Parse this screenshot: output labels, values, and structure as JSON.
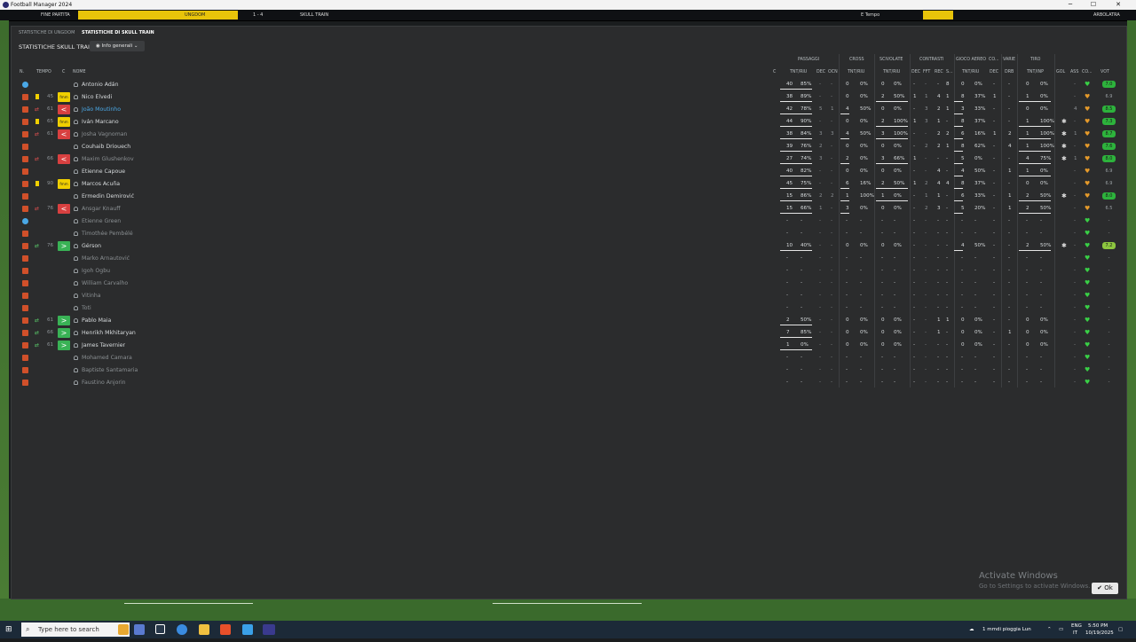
{
  "window": {
    "title": "Football Manager 2024",
    "min": "─",
    "max": "☐",
    "close": "✕"
  },
  "gamebar": {
    "end": "FINE PARTITA",
    "home": "UNGDOM",
    "score": "1 - 4",
    "away": "SKULL TRAIN",
    "time": "E Tempo",
    "right": "ARBOLATRA"
  },
  "tabs": [
    "STATISTICHE DI UNGDOM",
    "STATISTICHE DI SKULL TRAIN"
  ],
  "subtitle": "STATISTICHE SKULL TRAIN",
  "dropdown": {
    "label": "Info generali",
    "icon": "eye-icon"
  },
  "groups": {
    "passaggi": "PASSAGGI",
    "cross": "CROSS",
    "scivolate": "SCIVOLATE",
    "contrasti": "CONTRASTI",
    "gioco_aereo": "GIOCO AEREO",
    "co": "CO...",
    "varie": "VARIE",
    "tiro": "TIRO"
  },
  "headers": {
    "n": "N.",
    "tempo": "TEMPO",
    "c": "C",
    "nome": "NOME",
    "c2": "C",
    "pass_tnt": "TNT/RIU",
    "pass_dec": "DEC",
    "pass_occ": "OCN",
    "cross_tnt": "TNT/RIU",
    "sciv_tnt": "TNT/RIU",
    "contr_dec": "DEC",
    "contr_fft": "FFT",
    "contr_rec": "REC",
    "contr_s": "S...",
    "aereo_tnt": "TNT/RIU",
    "aereo_dec": "DEC",
    "varie_drb": "DRB",
    "tiro_tnt": "TNT/INP",
    "gol": "GOL",
    "ass": "ASS",
    "co": "CO...",
    "vot": "VOT"
  },
  "players": [
    {
      "name": "Antonio Adán",
      "style": "normal",
      "pos": "gk",
      "card": "",
      "sub": "",
      "min": "",
      "badge": "",
      "shirt": "",
      "pass": [
        "40",
        "85%"
      ],
      "dec": "-",
      "occ": "-",
      "cross": [
        "0",
        "0%"
      ],
      "sciv": [
        "0",
        "0%"
      ],
      "cd": "-",
      "cf": "-",
      "cr": "-",
      "cs": "8",
      "aer": [
        "0",
        "0%"
      ],
      "adec": "-",
      "drb": "-",
      "tiro": [
        "0",
        "0%"
      ],
      "gol": "",
      "ass": "-",
      "heart": "g",
      "rating": "7.0",
      "rclass": "g"
    },
    {
      "name": "Nico Elvedi",
      "style": "normal",
      "pos": "out",
      "card": "y",
      "sub": "",
      "min": "45",
      "badge": "cap",
      "shirt": "",
      "pass": [
        "38",
        "89%"
      ],
      "dec": "-",
      "occ": "-",
      "cross": [
        "0",
        "0%"
      ],
      "sciv": [
        "2",
        "50%"
      ],
      "cd": "1",
      "cf": "1",
      "cr": "4",
      "cs": "1",
      "aer": [
        "8",
        "37%"
      ],
      "adec": "1",
      "drb": "-",
      "tiro": [
        "1",
        "0%"
      ],
      "gol": "",
      "ass": "-",
      "heart": "o",
      "rating": "6.9",
      "rclass": "none"
    },
    {
      "name": "João Moutinho",
      "style": "blue",
      "pos": "out",
      "card": "",
      "sub": "out",
      "min": "61",
      "badge": "off",
      "shirt": "",
      "pass": [
        "42",
        "78%"
      ],
      "dec": "5",
      "occ": "1",
      "cross": [
        "4",
        "50%"
      ],
      "sciv": [
        "0",
        "0%"
      ],
      "cd": "-",
      "cf": "3",
      "cr": "2",
      "cs": "1",
      "aer": [
        "3",
        "33%"
      ],
      "adec": "-",
      "drb": "-",
      "tiro": [
        "0",
        "0%"
      ],
      "gol": "",
      "ass": "4",
      "heart": "o",
      "rating": "8.5",
      "rclass": "g"
    },
    {
      "name": "Iván Marcano",
      "style": "normal",
      "pos": "out",
      "card": "y",
      "sub": "",
      "min": "65",
      "badge": "cap",
      "shirt": "",
      "pass": [
        "44",
        "90%"
      ],
      "dec": "-",
      "occ": "-",
      "cross": [
        "0",
        "0%"
      ],
      "sciv": [
        "2",
        "100%"
      ],
      "cd": "1",
      "cf": "3",
      "cr": "1",
      "cs": "-",
      "aer": [
        "8",
        "37%"
      ],
      "adec": "-",
      "drb": "-",
      "tiro": [
        "1",
        "100%"
      ],
      "gol": "g",
      "ass": "-",
      "heart": "o",
      "rating": "7.3",
      "rclass": "g"
    },
    {
      "name": "Josha Vagnoman",
      "style": "grey",
      "pos": "out",
      "card": "",
      "sub": "out",
      "min": "61",
      "badge": "off",
      "shirt": "",
      "pass": [
        "38",
        "84%"
      ],
      "dec": "3",
      "occ": "3",
      "cross": [
        "4",
        "50%"
      ],
      "sciv": [
        "3",
        "100%"
      ],
      "cd": "-",
      "cf": "-",
      "cr": "2",
      "cs": "2",
      "aer": [
        "6",
        "16%"
      ],
      "adec": "1",
      "drb": "2",
      "tiro": [
        "1",
        "100%"
      ],
      "gol": "g",
      "ass": "1",
      "heart": "o",
      "rating": "8.7",
      "rclass": "g"
    },
    {
      "name": "Couhaib Driouech",
      "style": "normal",
      "pos": "out",
      "card": "",
      "sub": "",
      "min": "",
      "badge": "",
      "shirt": "",
      "pass": [
        "39",
        "76%"
      ],
      "dec": "2",
      "occ": "-",
      "cross": [
        "0",
        "0%"
      ],
      "sciv": [
        "0",
        "0%"
      ],
      "cd": "-",
      "cf": "2",
      "cr": "2",
      "cs": "1",
      "aer": [
        "8",
        "62%"
      ],
      "adec": "-",
      "drb": "4",
      "tiro": [
        "1",
        "100%"
      ],
      "gol": "g",
      "ass": "-",
      "heart": "o",
      "rating": "7.6",
      "rclass": "g"
    },
    {
      "name": "Maxim Glushenkov",
      "style": "grey",
      "pos": "out",
      "card": "",
      "sub": "out",
      "min": "66",
      "badge": "off",
      "shirt": "",
      "pass": [
        "27",
        "74%"
      ],
      "dec": "3",
      "occ": "-",
      "cross": [
        "2",
        "0%"
      ],
      "sciv": [
        "3",
        "66%"
      ],
      "cd": "1",
      "cf": "-",
      "cr": "-",
      "cs": "-",
      "aer": [
        "5",
        "0%"
      ],
      "adec": "-",
      "drb": "-",
      "tiro": [
        "4",
        "75%"
      ],
      "gol": "g",
      "ass": "1",
      "heart": "o",
      "rating": "8.0",
      "rclass": "g"
    },
    {
      "name": "Etienne Capoue",
      "style": "normal",
      "pos": "out",
      "card": "",
      "sub": "",
      "min": "",
      "badge": "",
      "shirt": "",
      "pass": [
        "40",
        "82%"
      ],
      "dec": "-",
      "occ": "-",
      "cross": [
        "0",
        "0%"
      ],
      "sciv": [
        "0",
        "0%"
      ],
      "cd": "-",
      "cf": "-",
      "cr": "4",
      "cs": "-",
      "aer": [
        "4",
        "50%"
      ],
      "adec": "-",
      "drb": "1",
      "tiro": [
        "1",
        "0%"
      ],
      "gol": "",
      "ass": "-",
      "heart": "o",
      "rating": "6.9",
      "rclass": "none"
    },
    {
      "name": "Marcos Acuña",
      "style": "normal",
      "pos": "out",
      "card": "y",
      "sub": "",
      "min": "90",
      "badge": "cap",
      "shirt": "",
      "pass": [
        "45",
        "75%"
      ],
      "dec": "-",
      "occ": "-",
      "cross": [
        "6",
        "16%"
      ],
      "sciv": [
        "2",
        "50%"
      ],
      "cd": "1",
      "cf": "2",
      "cr": "4",
      "cs": "4",
      "aer": [
        "8",
        "37%"
      ],
      "adec": "-",
      "drb": "-",
      "tiro": [
        "0",
        "0%"
      ],
      "gol": "",
      "ass": "-",
      "heart": "o",
      "rating": "6.9",
      "rclass": "none"
    },
    {
      "name": "Ermedin Demirović",
      "style": "normal",
      "pos": "out",
      "card": "",
      "sub": "",
      "min": "",
      "badge": "",
      "shirt": "",
      "pass": [
        "15",
        "86%"
      ],
      "dec": "2",
      "occ": "2",
      "cross": [
        "1",
        "100%"
      ],
      "sciv": [
        "1",
        "0%"
      ],
      "cd": "-",
      "cf": "1",
      "cr": "1",
      "cs": "-",
      "aer": [
        "6",
        "33%"
      ],
      "adec": "-",
      "drb": "1",
      "tiro": [
        "2",
        "50%"
      ],
      "gol": "g",
      "ass": "-",
      "heart": "o",
      "rating": "8.0",
      "rclass": "g"
    },
    {
      "name": "Ansgar Knauff",
      "style": "grey",
      "pos": "out",
      "card": "",
      "sub": "out",
      "min": "76",
      "badge": "off",
      "shirt": "",
      "pass": [
        "15",
        "66%"
      ],
      "dec": "1",
      "occ": "-",
      "cross": [
        "3",
        "0%"
      ],
      "sciv": [
        "0",
        "0%"
      ],
      "cd": "-",
      "cf": "2",
      "cr": "3",
      "cs": "-",
      "aer": [
        "5",
        "20%"
      ],
      "adec": "-",
      "drb": "1",
      "tiro": [
        "2",
        "50%"
      ],
      "gol": "",
      "ass": "-",
      "heart": "o",
      "rating": "6.5",
      "rclass": "none"
    },
    {
      "name": "Etienne Green",
      "style": "grey",
      "pos": "gk",
      "card": "",
      "sub": "",
      "min": "",
      "badge": "",
      "shirt": "",
      "pass": [
        "-",
        "-"
      ],
      "dec": "-",
      "occ": "-",
      "cross": [
        "-",
        "-"
      ],
      "sciv": [
        "-",
        "-"
      ],
      "cd": "-",
      "cf": "-",
      "cr": "-",
      "cs": "-",
      "aer": [
        "-",
        "-"
      ],
      "adec": "-",
      "drb": "-",
      "tiro": [
        "-",
        "-"
      ],
      "gol": "",
      "ass": "-",
      "heart": "g",
      "rating": "-",
      "rclass": "none"
    },
    {
      "name": "Timothée Pembélé",
      "style": "grey",
      "pos": "out",
      "card": "",
      "sub": "",
      "min": "",
      "badge": "",
      "shirt": "",
      "pass": [
        "-",
        "-"
      ],
      "dec": "-",
      "occ": "-",
      "cross": [
        "-",
        "-"
      ],
      "sciv": [
        "-",
        "-"
      ],
      "cd": "-",
      "cf": "-",
      "cr": "-",
      "cs": "-",
      "aer": [
        "-",
        "-"
      ],
      "adec": "-",
      "drb": "-",
      "tiro": [
        "-",
        "-"
      ],
      "gol": "",
      "ass": "-",
      "heart": "g",
      "rating": "-",
      "rclass": "none"
    },
    {
      "name": "Gérson",
      "style": "normal",
      "pos": "out",
      "card": "",
      "sub": "in",
      "min": "76",
      "badge": "on",
      "shirt": "",
      "pass": [
        "10",
        "40%"
      ],
      "dec": "-",
      "occ": "-",
      "cross": [
        "0",
        "0%"
      ],
      "sciv": [
        "0",
        "0%"
      ],
      "cd": "-",
      "cf": "-",
      "cr": "-",
      "cs": "-",
      "aer": [
        "4",
        "50%"
      ],
      "adec": "-",
      "drb": "-",
      "tiro": [
        "2",
        "50%"
      ],
      "gol": "g",
      "ass": "-",
      "heart": "g",
      "rating": "7.2",
      "rclass": "y"
    },
    {
      "name": "Marko Arnautović",
      "style": "grey",
      "pos": "out",
      "card": "",
      "sub": "",
      "min": "",
      "badge": "",
      "shirt": "",
      "pass": [
        "-",
        "-"
      ],
      "dec": "-",
      "occ": "-",
      "cross": [
        "-",
        "-"
      ],
      "sciv": [
        "-",
        "-"
      ],
      "cd": "-",
      "cf": "-",
      "cr": "-",
      "cs": "-",
      "aer": [
        "-",
        "-"
      ],
      "adec": "-",
      "drb": "-",
      "tiro": [
        "-",
        "-"
      ],
      "gol": "",
      "ass": "-",
      "heart": "g",
      "rating": "-",
      "rclass": "none"
    },
    {
      "name": "Igoh Ogbu",
      "style": "grey",
      "pos": "out",
      "card": "",
      "sub": "",
      "min": "",
      "badge": "",
      "shirt": "",
      "pass": [
        "-",
        "-"
      ],
      "dec": "-",
      "occ": "-",
      "cross": [
        "-",
        "-"
      ],
      "sciv": [
        "-",
        "-"
      ],
      "cd": "-",
      "cf": "-",
      "cr": "-",
      "cs": "-",
      "aer": [
        "-",
        "-"
      ],
      "adec": "-",
      "drb": "-",
      "tiro": [
        "-",
        "-"
      ],
      "gol": "",
      "ass": "-",
      "heart": "g",
      "rating": "-",
      "rclass": "none"
    },
    {
      "name": "William Carvalho",
      "style": "grey",
      "pos": "out",
      "card": "",
      "sub": "",
      "min": "",
      "badge": "",
      "shirt": "",
      "pass": [
        "-",
        "-"
      ],
      "dec": "-",
      "occ": "-",
      "cross": [
        "-",
        "-"
      ],
      "sciv": [
        "-",
        "-"
      ],
      "cd": "-",
      "cf": "-",
      "cr": "-",
      "cs": "-",
      "aer": [
        "-",
        "-"
      ],
      "adec": "-",
      "drb": "-",
      "tiro": [
        "-",
        "-"
      ],
      "gol": "",
      "ass": "-",
      "heart": "g",
      "rating": "-",
      "rclass": "none"
    },
    {
      "name": "Vitinha",
      "style": "grey",
      "pos": "out",
      "card": "",
      "sub": "",
      "min": "",
      "badge": "",
      "shirt": "",
      "pass": [
        "-",
        "-"
      ],
      "dec": "-",
      "occ": "-",
      "cross": [
        "-",
        "-"
      ],
      "sciv": [
        "-",
        "-"
      ],
      "cd": "-",
      "cf": "-",
      "cr": "-",
      "cs": "-",
      "aer": [
        "-",
        "-"
      ],
      "adec": "-",
      "drb": "-",
      "tiro": [
        "-",
        "-"
      ],
      "gol": "",
      "ass": "-",
      "heart": "g",
      "rating": "-",
      "rclass": "none"
    },
    {
      "name": "Toti",
      "style": "grey",
      "pos": "out",
      "card": "",
      "sub": "",
      "min": "",
      "badge": "",
      "shirt": "",
      "pass": [
        "-",
        "-"
      ],
      "dec": "-",
      "occ": "-",
      "cross": [
        "-",
        "-"
      ],
      "sciv": [
        "-",
        "-"
      ],
      "cd": "-",
      "cf": "-",
      "cr": "-",
      "cs": "-",
      "aer": [
        "-",
        "-"
      ],
      "adec": "-",
      "drb": "-",
      "tiro": [
        "-",
        "-"
      ],
      "gol": "",
      "ass": "-",
      "heart": "g",
      "rating": "-",
      "rclass": "none"
    },
    {
      "name": "Pablo Maia",
      "style": "normal",
      "pos": "out",
      "card": "",
      "sub": "in",
      "min": "61",
      "badge": "on",
      "shirt": "",
      "pass": [
        "2",
        "50%"
      ],
      "dec": "-",
      "occ": "-",
      "cross": [
        "0",
        "0%"
      ],
      "sciv": [
        "0",
        "0%"
      ],
      "cd": "-",
      "cf": "-",
      "cr": "1",
      "cs": "1",
      "aer": [
        "0",
        "0%"
      ],
      "adec": "-",
      "drb": "-",
      "tiro": [
        "0",
        "0%"
      ],
      "gol": "",
      "ass": "-",
      "heart": "g",
      "rating": "-",
      "rclass": "none"
    },
    {
      "name": "Henrikh Mkhitaryan",
      "style": "normal",
      "pos": "out",
      "card": "",
      "sub": "in",
      "min": "66",
      "badge": "on",
      "shirt": "",
      "pass": [
        "7",
        "85%"
      ],
      "dec": "-",
      "occ": "-",
      "cross": [
        "0",
        "0%"
      ],
      "sciv": [
        "0",
        "0%"
      ],
      "cd": "-",
      "cf": "-",
      "cr": "1",
      "cs": "-",
      "aer": [
        "0",
        "0%"
      ],
      "adec": "-",
      "drb": "1",
      "tiro": [
        "0",
        "0%"
      ],
      "gol": "",
      "ass": "-",
      "heart": "g",
      "rating": "-",
      "rclass": "none"
    },
    {
      "name": "James Tavernier",
      "style": "normal",
      "pos": "out",
      "card": "",
      "sub": "in",
      "min": "61",
      "badge": "on",
      "shirt": "",
      "pass": [
        "1",
        "0%"
      ],
      "dec": "-",
      "occ": "-",
      "cross": [
        "0",
        "0%"
      ],
      "sciv": [
        "0",
        "0%"
      ],
      "cd": "-",
      "cf": "-",
      "cr": "-",
      "cs": "-",
      "aer": [
        "0",
        "0%"
      ],
      "adec": "-",
      "drb": "-",
      "tiro": [
        "0",
        "0%"
      ],
      "gol": "",
      "ass": "-",
      "heart": "g",
      "rating": "-",
      "rclass": "none"
    },
    {
      "name": "Mohamed Camara",
      "style": "grey",
      "pos": "out",
      "card": "",
      "sub": "",
      "min": "",
      "badge": "",
      "shirt": "",
      "pass": [
        "-",
        "-"
      ],
      "dec": "-",
      "occ": "-",
      "cross": [
        "-",
        "-"
      ],
      "sciv": [
        "-",
        "-"
      ],
      "cd": "-",
      "cf": "-",
      "cr": "-",
      "cs": "-",
      "aer": [
        "-",
        "-"
      ],
      "adec": "-",
      "drb": "-",
      "tiro": [
        "-",
        "-"
      ],
      "gol": "",
      "ass": "-",
      "heart": "g",
      "rating": "-",
      "rclass": "none"
    },
    {
      "name": "Baptiste Santamaria",
      "style": "grey",
      "pos": "out",
      "card": "",
      "sub": "",
      "min": "",
      "badge": "",
      "shirt": "",
      "pass": [
        "-",
        "-"
      ],
      "dec": "-",
      "occ": "-",
      "cross": [
        "-",
        "-"
      ],
      "sciv": [
        "-",
        "-"
      ],
      "cd": "-",
      "cf": "-",
      "cr": "-",
      "cs": "-",
      "aer": [
        "-",
        "-"
      ],
      "adec": "-",
      "drb": "-",
      "tiro": [
        "-",
        "-"
      ],
      "gol": "",
      "ass": "-",
      "heart": "g",
      "rating": "-",
      "rclass": "none"
    },
    {
      "name": "Faustino Anjorin",
      "style": "grey",
      "pos": "out",
      "card": "",
      "sub": "",
      "min": "",
      "badge": "",
      "shirt": "",
      "pass": [
        "-",
        "-"
      ],
      "dec": "-",
      "occ": "-",
      "cross": [
        "-",
        "-"
      ],
      "sciv": [
        "-",
        "-"
      ],
      "cd": "-",
      "cf": "-",
      "cr": "-",
      "cs": "-",
      "aer": [
        "-",
        "-"
      ],
      "adec": "-",
      "drb": "-",
      "tiro": [
        "-",
        "-"
      ],
      "gol": "",
      "ass": "-",
      "heart": "g",
      "rating": "-",
      "rclass": "none"
    }
  ],
  "overlay": {
    "activate": "Activate Windows",
    "activate_sub": "Go to Settings to activate Windows.",
    "ok": "✔ Ok"
  },
  "taskbar": {
    "search_placeholder": "Type here to search",
    "weather": "1 mmdi pioggia Lun",
    "lang": "ENG",
    "lang2": "IT",
    "time": "5:50 PM",
    "date": "10/19/2025"
  },
  "colors": {
    "rating_green": "#2db33c",
    "heart_green": "#39d046",
    "heart_orange": "#e59a2a",
    "sub_off": "#d84040",
    "sub_on": "#39b255",
    "captain": "#f0d000"
  }
}
